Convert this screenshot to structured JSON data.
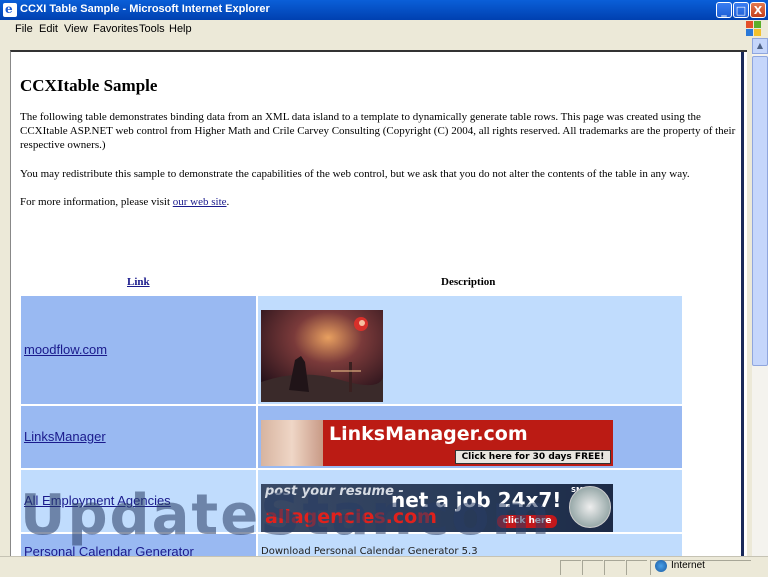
{
  "window": {
    "title": "CCXI Table Sample - Microsoft Internet Explorer",
    "buttons": [
      "_",
      "□",
      "X"
    ]
  },
  "menu": [
    "File",
    "Edit",
    "View",
    "Favorites",
    "Tools",
    "Help"
  ],
  "page": {
    "heading": "CCXItable Sample",
    "paragraph1": "The following table demonstrates binding data from an XML data island to a template to dynamically generate table rows. This page was created using the CCXItable ASP.NET web control from Higher Math and Crile Carvey Consulting (Copyright (C) 2004, all rights reserved. All trademarks are the property of their respective owners.)",
    "paragraph2": "You may redistribute this sample to demonstrate the capabilities of the web control, but we ask that you do not alter the contents of the table in any way.",
    "paragraph3_prefix": "For more information, please visit ",
    "paragraph3_link": "our web site",
    "paragraph3_suffix": "."
  },
  "table": {
    "headers": {
      "link": "Link",
      "description": "Description"
    },
    "rows": [
      {
        "link": "moodflow.com",
        "description_type": "image"
      },
      {
        "link": "LinksManager",
        "banner": {
          "text": "LinksManager.com",
          "cta": "Click here for 30 days FREE!"
        }
      },
      {
        "link": "All Employment Agencies",
        "banner": {
          "line1": "post your resume -",
          "line2": "allagencies.com",
          "main": "net a job 24x7!",
          "sm": "SM",
          "cta": "click here"
        }
      },
      {
        "link": "Personal Calendar Generator",
        "description": "Download Personal Calendar Generator 5.3"
      }
    ]
  },
  "watermark": "UpdateStar.com",
  "status": {
    "zone": "Internet"
  },
  "colors": {
    "link_cell_bg": "#99b9f2",
    "desc_cell_bg": "#c0dcfd",
    "link_color": "#1a1a8c"
  }
}
